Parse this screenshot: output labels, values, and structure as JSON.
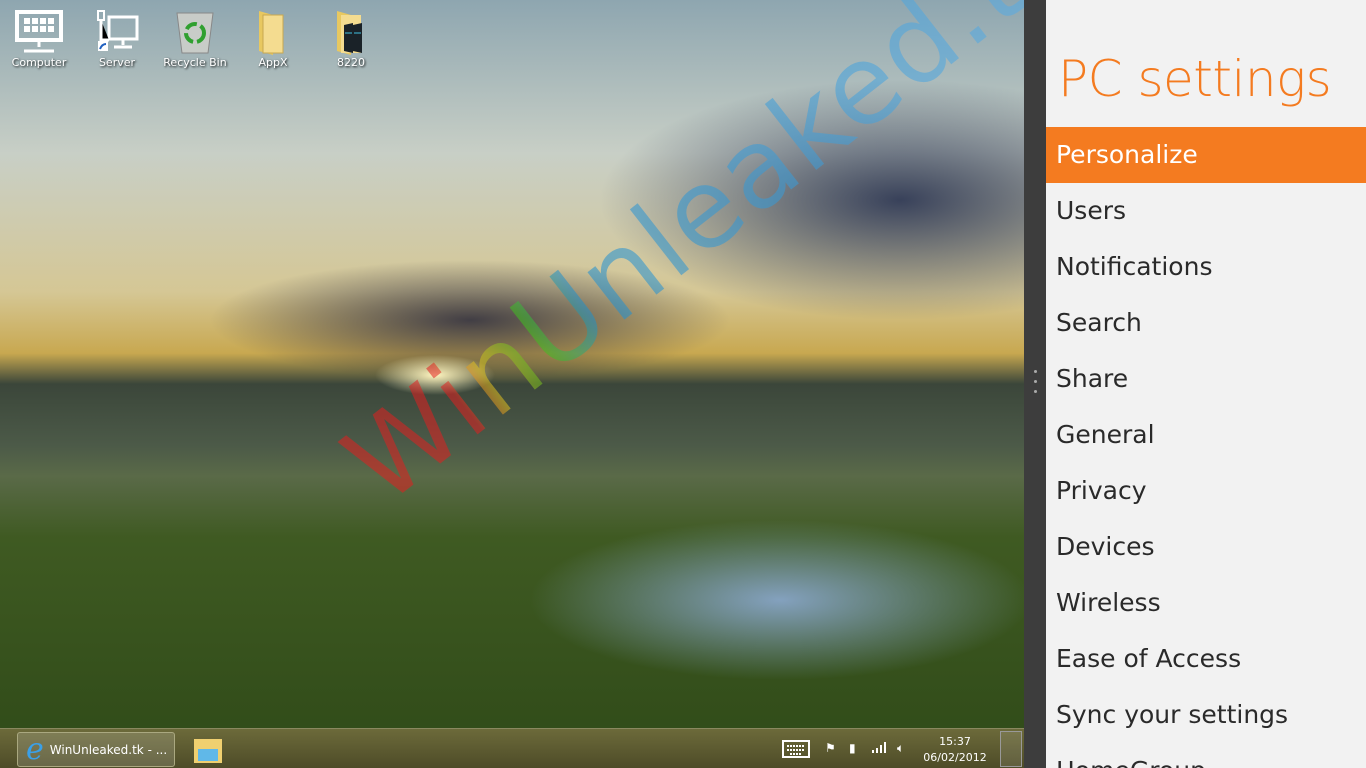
{
  "desktop": {
    "icons": [
      {
        "label": "Computer"
      },
      {
        "label": "Server"
      },
      {
        "label": "Recycle Bin"
      },
      {
        "label": "AppX"
      },
      {
        "label": "8220"
      }
    ],
    "watermark": "WinUnleaked.tk"
  },
  "taskbar": {
    "ie_button": "WinUnleaked.tk - ...",
    "clock_time": "15:37",
    "clock_date": "06/02/2012"
  },
  "settings": {
    "title": "PC settings",
    "accent": "#f47b20",
    "selected": "Personalize",
    "items": [
      "Personalize",
      "Users",
      "Notifications",
      "Search",
      "Share",
      "General",
      "Privacy",
      "Devices",
      "Wireless",
      "Ease of Access",
      "Sync your settings",
      "HomeGroup"
    ]
  }
}
